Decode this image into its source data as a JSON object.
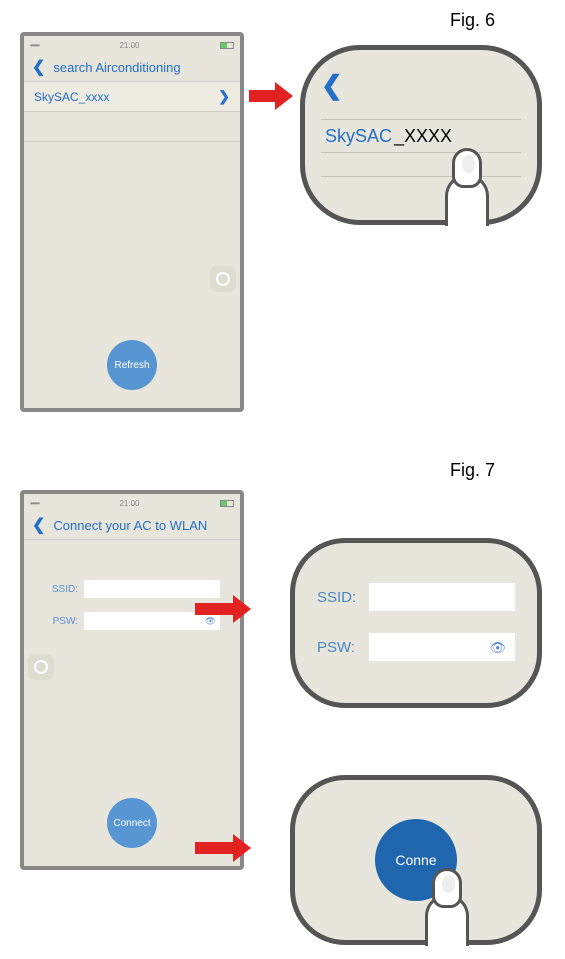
{
  "fig6": {
    "label": "Fig. 6"
  },
  "fig7": {
    "label": "Fig. 7"
  },
  "phone1": {
    "time": "21:00",
    "navTitle": "search Airconditioning",
    "row": {
      "label": "SkySAC_xxxx"
    },
    "refresh": "Refresh"
  },
  "zoom1": {
    "brand": "SkySAC",
    "suffix": "_XXXX"
  },
  "phone2": {
    "time": "21:00",
    "navTitle": "Connect your AC to WLAN",
    "ssidLabel": "SSID:",
    "pswLabel": "PSW:",
    "connect": "Connect"
  },
  "zoom2": {
    "ssidLabel": "SSID:",
    "pswLabel": "PSW:"
  },
  "zoom3": {
    "connect": "Conne"
  }
}
